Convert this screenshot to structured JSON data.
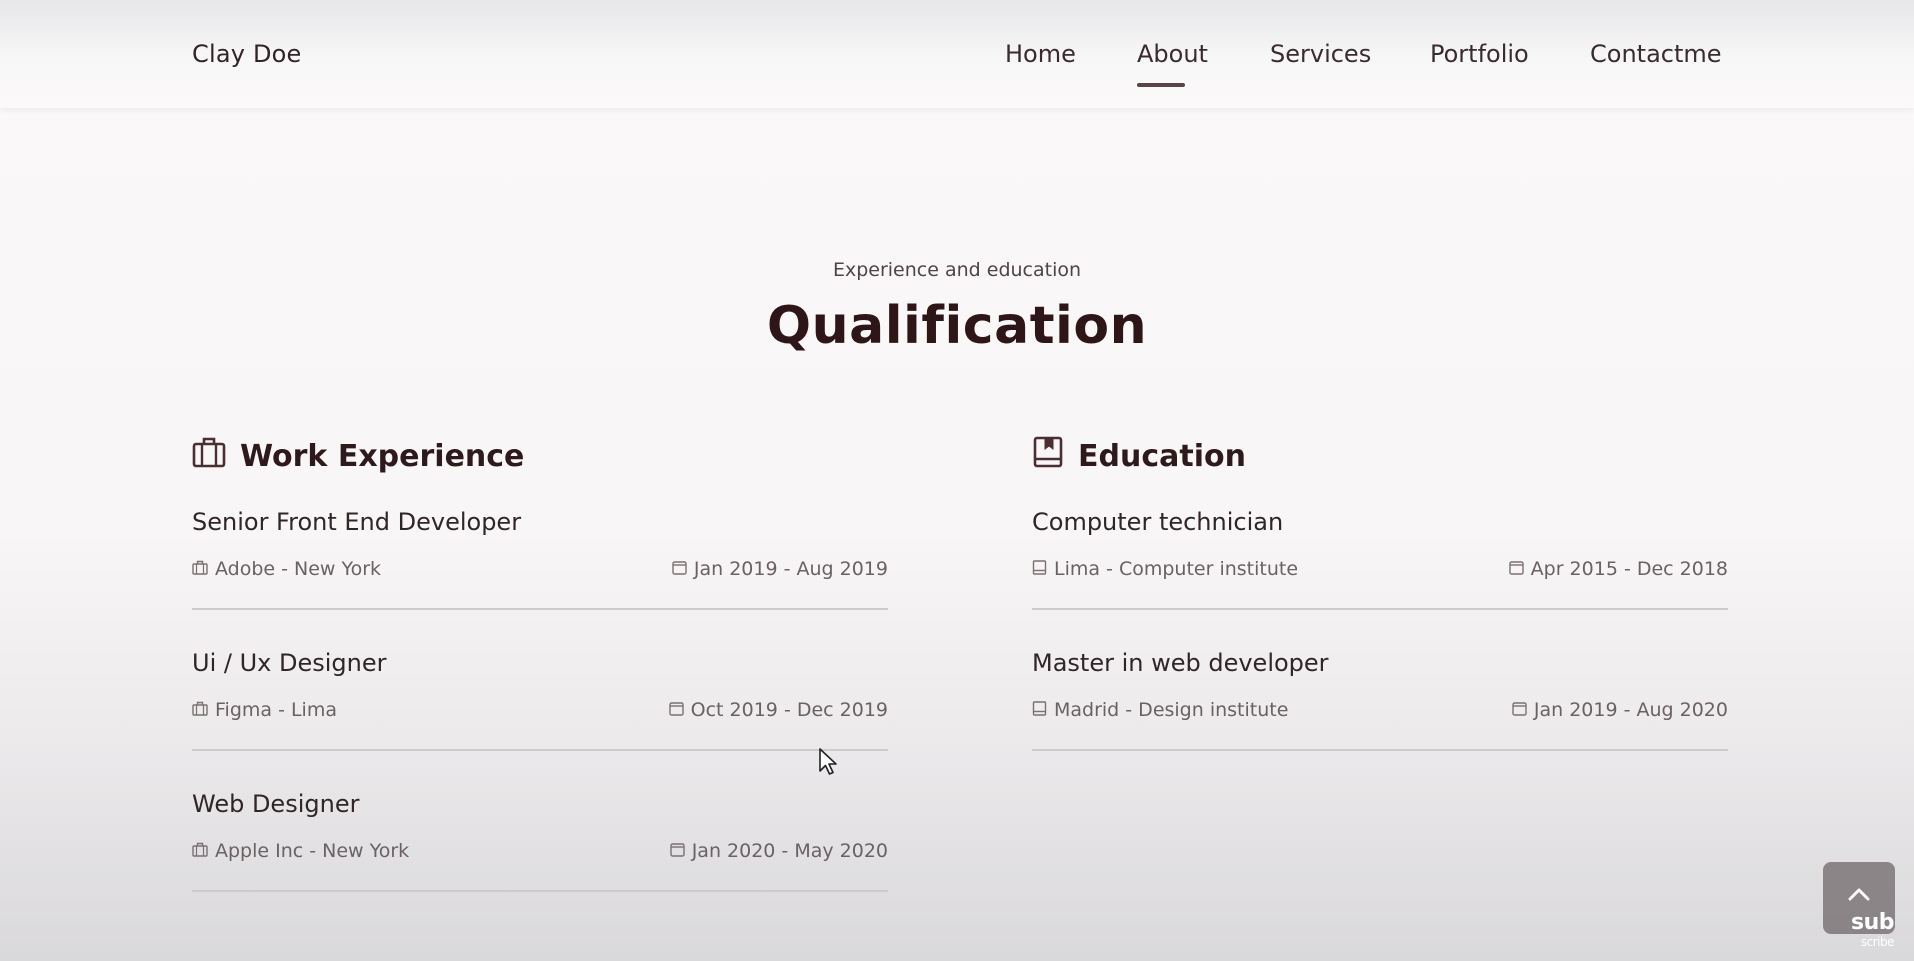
{
  "header": {
    "brand": "Clay Doe",
    "nav": [
      "Home",
      "About",
      "Services",
      "Portfolio",
      "Contactme"
    ],
    "active": "About"
  },
  "section": {
    "subtitle": "Experience and education",
    "title": "Qualification"
  },
  "work": {
    "heading": "Work Experience",
    "items": [
      {
        "title": "Senior Front End Developer",
        "place": "Adobe - New York",
        "date": "Jan 2019 - Aug 2019"
      },
      {
        "title": "Ui / Ux Designer",
        "place": "Figma - Lima",
        "date": "Oct 2019 - Dec 2019"
      },
      {
        "title": "Web Designer",
        "place": "Apple Inc - New York",
        "date": "Jan 2020 - May 2020"
      }
    ]
  },
  "education": {
    "heading": "Education",
    "items": [
      {
        "title": "Computer technician",
        "place": "Lima - Computer institute",
        "date": "Apr 2015 - Dec 2018"
      },
      {
        "title": "Master in web developer",
        "place": "Madrid - Design institute",
        "date": "Jan 2019 - Aug 2020"
      }
    ]
  },
  "overlay": {
    "sub_main": "sub",
    "sub_small": "scribe"
  },
  "icons": {
    "work": "briefcase-icon",
    "education": "book-icon",
    "date": "calendar-icon",
    "scroll": "chevron-up-icon"
  },
  "colors": {
    "title": "#2e1518",
    "text": "#3a2c2e",
    "muted": "#6a6163",
    "divider": "#cfcbcc",
    "scroll_button": "#7d7678"
  }
}
